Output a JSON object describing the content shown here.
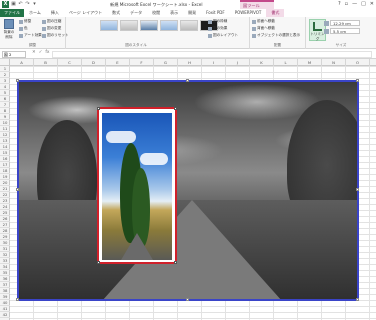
{
  "window": {
    "app_logo": "X",
    "title": "新規 Microsoft Excel ワークシート.xlsx - Excel",
    "context_tab_group": "図ツール",
    "controls": [
      "?",
      "▫",
      "—",
      "□",
      "✕"
    ]
  },
  "quick_access": [
    "save-icon",
    "undo-icon",
    "redo-icon",
    "customize-icon"
  ],
  "tabs": [
    {
      "label": "ファイル",
      "kind": "file"
    },
    {
      "label": "ホーム"
    },
    {
      "label": "挿入"
    },
    {
      "label": "ページ レイアウト"
    },
    {
      "label": "数式"
    },
    {
      "label": "データ"
    },
    {
      "label": "校閲"
    },
    {
      "label": "表示"
    },
    {
      "label": "開発"
    },
    {
      "label": "Foxit PDF"
    },
    {
      "label": "POWERPIVOT"
    },
    {
      "label": "書式",
      "kind": "active"
    }
  ],
  "ribbon": {
    "adjust": {
      "big_label": "背景の削除",
      "buttons": [
        "修整",
        "色",
        "アート効果"
      ],
      "buttons2": [
        "図の圧縮",
        "図の変更",
        "図のリセット"
      ],
      "group_label": "調整"
    },
    "styles": {
      "group_label": "図のスタイル"
    },
    "style_opts": [
      "図の枠線",
      "図の効果",
      "図のレイアウト"
    ],
    "arrange": {
      "buttons": [
        "前面へ移動",
        "背面へ移動",
        "オブジェクトの選択と表示"
      ],
      "group_label": "配置"
    },
    "size": {
      "crop_label": "トリミング",
      "height": "12.29 cm",
      "width": "5.5 cm",
      "group_label": "サイズ"
    }
  },
  "formula_bar": {
    "name_box": "図 2",
    "icons": [
      "✕",
      "✓",
      "fx"
    ],
    "value": ""
  },
  "columns": [
    "A",
    "B",
    "C",
    "D",
    "E",
    "F",
    "G",
    "H",
    "I",
    "J",
    "K",
    "L",
    "M",
    "N",
    "O"
  ],
  "rows": [
    "1",
    "2",
    "3",
    "4",
    "5",
    "6",
    "7",
    "8",
    "9",
    "10",
    "11",
    "12",
    "13",
    "14",
    "15",
    "16",
    "17",
    "18",
    "19",
    "20",
    "21",
    "22",
    "23",
    "24",
    "25",
    "26",
    "27",
    "28",
    "29",
    "30",
    "31",
    "32",
    "33",
    "34",
    "35",
    "36",
    "37",
    "38",
    "39",
    "40",
    "41",
    "42"
  ],
  "colors": {
    "excel_green": "#217346",
    "context_pink": "#c3488a",
    "main_frame": "#3a44c8",
    "crop_frame": "#d0202a"
  }
}
